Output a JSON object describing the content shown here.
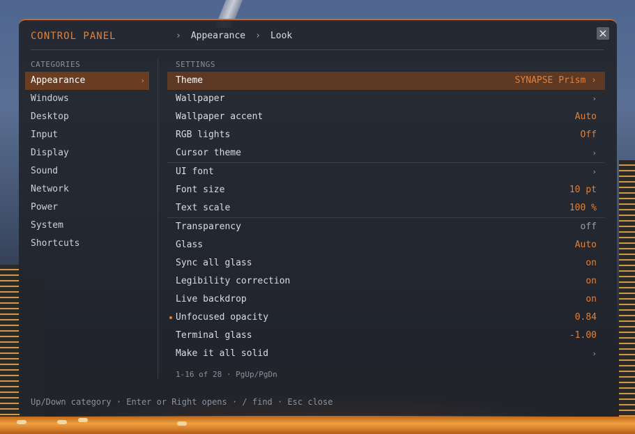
{
  "panel": {
    "title": "CONTROL PANEL",
    "breadcrumb": [
      "Appearance",
      "Look"
    ],
    "breadcrumb_sep": "›",
    "close_icon": "×"
  },
  "categories": {
    "heading": "CATEGORIES",
    "items": [
      {
        "label": "Appearance",
        "active": true,
        "chev": "›"
      },
      {
        "label": "Windows"
      },
      {
        "label": "Desktop"
      },
      {
        "label": "Input"
      },
      {
        "label": "Display"
      },
      {
        "label": "Sound"
      },
      {
        "label": "Network"
      },
      {
        "label": "Power"
      },
      {
        "label": "System"
      },
      {
        "label": "Shortcuts"
      }
    ]
  },
  "settings": {
    "heading": "SETTINGS",
    "items": [
      {
        "label": "Theme",
        "value": "SYNAPSE Prism ›",
        "active": true
      },
      {
        "label": "Wallpaper",
        "chev": "›"
      },
      {
        "label": "Wallpaper accent",
        "value": "Auto"
      },
      {
        "label": "RGB lights",
        "value": "Off"
      },
      {
        "label": "Cursor theme",
        "chev": "›"
      },
      {
        "label": "UI font",
        "chev": "›"
      },
      {
        "label": "Font size",
        "value": "10 pt"
      },
      {
        "label": "Text scale",
        "value": "100 %"
      },
      {
        "label": "Transparency",
        "value": "off",
        "dim": true
      },
      {
        "label": "Glass",
        "value": "Auto"
      },
      {
        "label": "Sync all glass",
        "value": "on"
      },
      {
        "label": "Legibility correction",
        "value": "on"
      },
      {
        "label": "Live backdrop",
        "value": "on"
      },
      {
        "label": "Unfocused opacity",
        "value": "0.84",
        "modified": true
      },
      {
        "label": "Terminal glass",
        "value": "-1.00"
      },
      {
        "label": "Make it all solid",
        "chev": "›"
      }
    ]
  },
  "pager": "1-16 of 28 · PgUp/PgDn",
  "footer": "Up/Down category · Enter or Right opens · / find · Esc close",
  "colors": {
    "accent": "#e0823a",
    "active_row": "#5e3a24",
    "panel_bg": "#21252c"
  }
}
